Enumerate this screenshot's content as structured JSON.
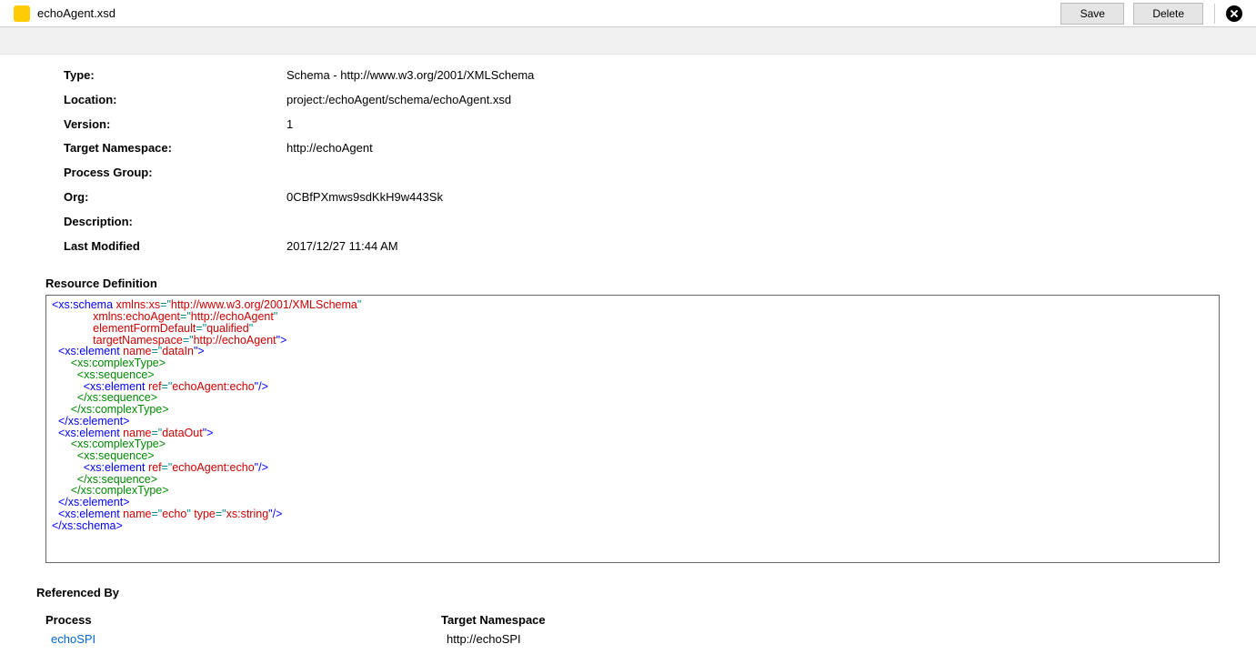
{
  "header": {
    "title": "echoAgent.xsd",
    "save_label": "Save",
    "delete_label": "Delete"
  },
  "properties": [
    {
      "label": "Type:",
      "value": "Schema - http://www.w3.org/2001/XMLSchema"
    },
    {
      "label": "Location:",
      "value": "project:/echoAgent/schema/echoAgent.xsd"
    },
    {
      "label": "Version:",
      "value": "1"
    },
    {
      "label": "Target Namespace:",
      "value": "http://echoAgent"
    },
    {
      "label": "Process Group:",
      "value": ""
    },
    {
      "label": "Org:",
      "value": "0CBfPXmws9sdKkH9w443Sk"
    },
    {
      "label": "Description:",
      "value": ""
    },
    {
      "label": "Last Modified",
      "value": "2017/12/27 11:44 AM"
    }
  ],
  "resource_definition_heading": "Resource Definition",
  "xml": {
    "l1_a": "<xs:schema",
    "l1_b": " xmlns:xs",
    "l1_c": "=\"",
    "l1_d": "http://www.w3.org/2001/XMLSchema",
    "l1_e": "\"",
    "l2_a": "             xmlns:echoAgent",
    "l2_b": "=\"",
    "l2_c": "http://echoAgent",
    "l2_d": "\"",
    "l3_a": "             elementFormDefault",
    "l3_b": "=\"",
    "l3_c": "qualified",
    "l3_d": "\"",
    "l4_a": "             targetNamespace",
    "l4_b": "=\"",
    "l4_c": "http://echoAgent",
    "l4_d": "\">",
    "l5_a": "  <xs:element",
    "l5_b": " name",
    "l5_c": "=\"",
    "l5_d": "dataIn",
    "l5_e": "\">",
    "l6": "      <xs:complexType>",
    "l7": "        <xs:sequence>",
    "l8_a": "          <xs:element",
    "l8_b": " ref",
    "l8_c": "=\"",
    "l8_d": "echoAgent:echo",
    "l8_e": "\"/>",
    "l9": "        </xs:sequence>",
    "l10": "      </xs:complexType>",
    "l11": "  </xs:element>",
    "l12_a": "  <xs:element",
    "l12_b": " name",
    "l12_c": "=\"",
    "l12_d": "dataOut",
    "l12_e": "\">",
    "l13": "      <xs:complexType>",
    "l14": "        <xs:sequence>",
    "l15_a": "          <xs:element",
    "l15_b": " ref",
    "l15_c": "=\"",
    "l15_d": "echoAgent:echo",
    "l15_e": "\"/>",
    "l16": "        </xs:sequence>",
    "l17": "      </xs:complexType>",
    "l18": "  </xs:element>",
    "l19_a": "  <xs:element",
    "l19_b": " name",
    "l19_c": "=\"",
    "l19_d": "echo",
    "l19_e": "\"",
    "l19_f": " type",
    "l19_g": "=\"",
    "l19_h": "xs:string",
    "l19_i": "\"/>",
    "l20": "</xs:schema>"
  },
  "referenced_by": {
    "heading": "Referenced By",
    "process_header": "Process",
    "target_ns_header": "Target Namespace",
    "rows": [
      {
        "process": "echoSPI",
        "target_ns": "http://echoSPI"
      }
    ]
  }
}
